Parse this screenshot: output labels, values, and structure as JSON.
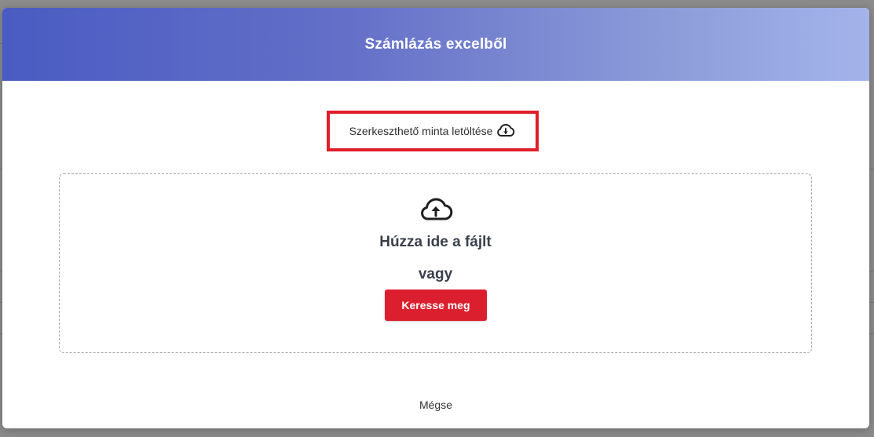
{
  "modal": {
    "title": "Számlázás excelből",
    "template_link_label": "Szerkeszthető minta letöltése",
    "dropzone": {
      "title": "Húzza ide a fájlt",
      "or_text": "vagy",
      "browse_label": "Keresse meg"
    },
    "cancel_label": "Mégse"
  },
  "colors": {
    "header_start": "#4a5bc2",
    "header_end": "#a4b4ea",
    "accent_red": "#dc1f2e",
    "highlight_border": "#e01e2b"
  },
  "icons": {
    "template_download": "cloud-download-icon",
    "dropzone_upload": "cloud-upload-icon"
  }
}
